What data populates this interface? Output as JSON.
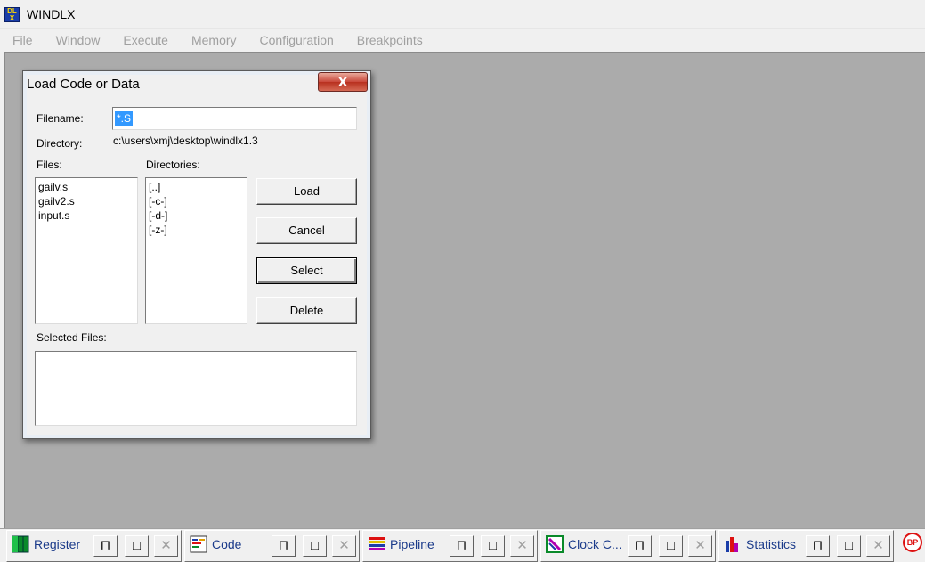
{
  "window": {
    "title": "WINDLX",
    "icon": "windlx-app-icon"
  },
  "menu": [
    "File",
    "Window",
    "Execute",
    "Memory",
    "Configuration",
    "Breakpoints"
  ],
  "dialog": {
    "title": "Load Code or Data",
    "close_label": "X",
    "filename_label": "Filename:",
    "filename_value": "*.S",
    "directory_label": "Directory:",
    "directory_value": "c:\\users\\xmj\\desktop\\windlx1.3",
    "files_label": "Files:",
    "files": [
      "gailv.s",
      "gailv2.s",
      "input.s"
    ],
    "directories_label": "Directories:",
    "directories": [
      "[..]",
      "[-c-]",
      "[-d-]",
      "[-z-]"
    ],
    "buttons": {
      "load": "Load",
      "cancel": "Cancel",
      "select": "Select",
      "delete": "Delete"
    },
    "selected_files_label": "Selected Files:",
    "selected_files": []
  },
  "taskbar": [
    {
      "label": "Register",
      "icon": "register-icon"
    },
    {
      "label": "Code",
      "icon": "code-icon"
    },
    {
      "label": "Pipeline",
      "icon": "pipeline-icon"
    },
    {
      "label": "Clock C...",
      "icon": "clock-cycle-icon"
    },
    {
      "label": "Statistics",
      "icon": "statistics-icon"
    }
  ],
  "taskbar_buttons": {
    "restore": "⊓",
    "maximize": "□",
    "close": "✕"
  },
  "breakpoint_icon": {
    "label": "BP",
    "icon": "breakpoint-icon"
  },
  "colors": {
    "mdi_background": "#ababab",
    "selection": "#3399ff",
    "taskbar_text": "#1a3a8a"
  }
}
